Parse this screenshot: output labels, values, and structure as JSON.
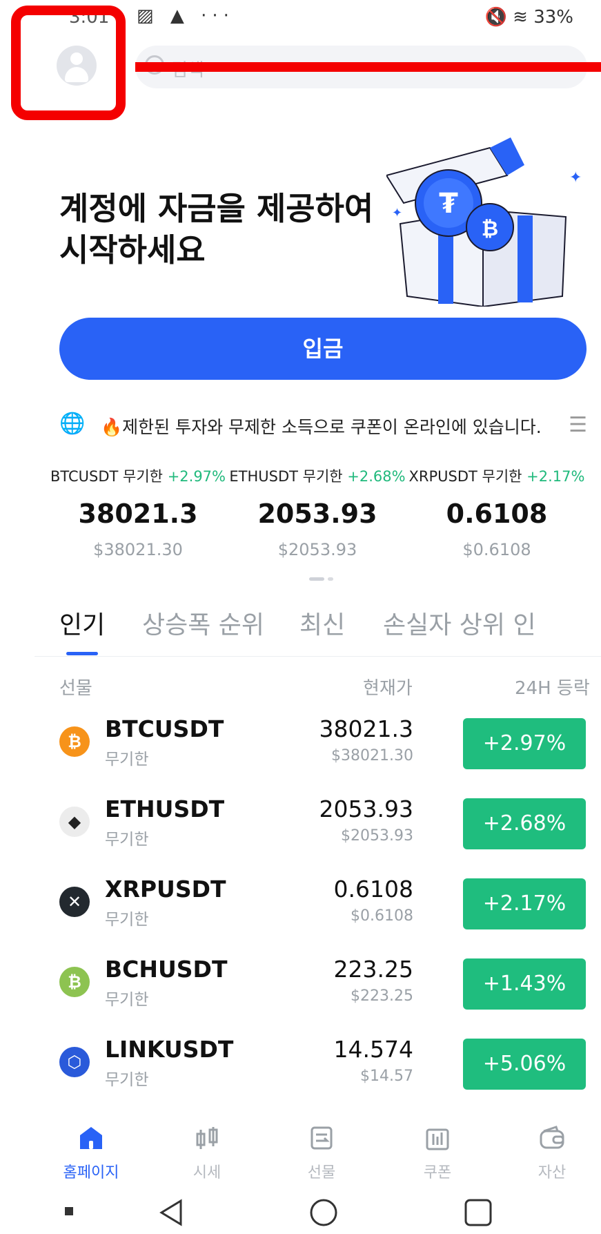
{
  "status_bar": {
    "time": "3:01",
    "left_icons": "▨ ▲ ···",
    "right_text": "🔇 ≋ 33%"
  },
  "search": {
    "placeholder": "검색"
  },
  "hero": {
    "title_line1": "계정에 자금을 제공하여",
    "title_line2": "시작하세요",
    "deposit_label": "입금"
  },
  "announcement": {
    "icon": "globe-icon",
    "text": "🔥제한된 투자와 무제한 소득으로 쿠폰이 온라인에 있습니다."
  },
  "tickers": [
    {
      "symbol": "BTCUSDT 무기한",
      "change": "+2.97%",
      "price": "38021.3",
      "usd": "$38021.30"
    },
    {
      "symbol": "ETHUSDT 무기한",
      "change": "+2.68%",
      "price": "2053.93",
      "usd": "$2053.93"
    },
    {
      "symbol": "XRPUSDT 무기한",
      "change": "+2.17%",
      "price": "0.6108",
      "usd": "$0.6108"
    }
  ],
  "tabs": [
    "인기",
    "상승폭 순위",
    "최신",
    "손실자 상위 인"
  ],
  "table_header": {
    "col1": "선물",
    "col2": "현재가",
    "col3": "24H 등락"
  },
  "rows": [
    {
      "name": "BTCUSDT",
      "sub": "무기한",
      "price": "38021.3",
      "usd": "$38021.30",
      "change": "+2.97%",
      "icon": "₿",
      "color": "#f7931a"
    },
    {
      "name": "ETHUSDT",
      "sub": "무기한",
      "price": "2053.93",
      "usd": "$2053.93",
      "change": "+2.68%",
      "icon": "◆",
      "color": "#ececec"
    },
    {
      "name": "XRPUSDT",
      "sub": "무기한",
      "price": "0.6108",
      "usd": "$0.6108",
      "change": "+2.17%",
      "icon": "✕",
      "color": "#23292f"
    },
    {
      "name": "BCHUSDT",
      "sub": "무기한",
      "price": "223.25",
      "usd": "$223.25",
      "change": "+1.43%",
      "icon": "₿",
      "color": "#8dc351"
    },
    {
      "name": "LINKUSDT",
      "sub": "무기한",
      "price": "14.574",
      "usd": "$14.57",
      "change": "+5.06%",
      "icon": "⬡",
      "color": "#2a5ada"
    }
  ],
  "bottom_nav": [
    {
      "label": "홈페이지",
      "icon": "home-icon"
    },
    {
      "label": "시세",
      "icon": "market-icon"
    },
    {
      "label": "선물",
      "icon": "futures-icon"
    },
    {
      "label": "쿠폰",
      "icon": "coupon-icon"
    },
    {
      "label": "자산",
      "icon": "wallet-icon"
    }
  ],
  "colors": {
    "accent": "#2962f6",
    "up": "#1fbd7e",
    "highlight": "#f40000"
  }
}
